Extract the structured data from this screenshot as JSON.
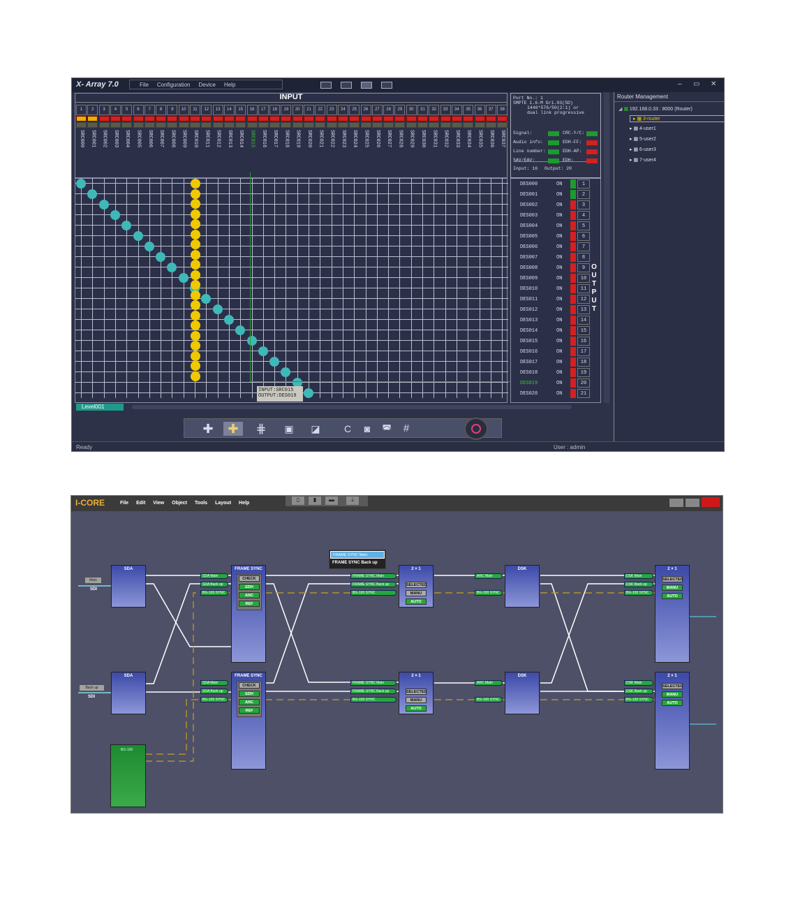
{
  "xarray": {
    "title": "X- Array 7.0",
    "menu": [
      "File",
      "Configuration",
      "Device",
      "Help"
    ],
    "window_controls": [
      "–",
      "▭",
      "✕"
    ],
    "input_header": "INPUT",
    "column_numbers": [
      "1",
      "2",
      "3",
      "4",
      "5",
      "6",
      "7",
      "8",
      "9",
      "10",
      "11",
      "12",
      "13",
      "14",
      "15",
      "16",
      "17",
      "18",
      "19",
      "20",
      "21",
      "22",
      "23",
      "24",
      "25",
      "26",
      "27",
      "28",
      "29",
      "30",
      "31",
      "32",
      "33",
      "34",
      "35",
      "36",
      "37",
      "38"
    ],
    "source_labels": [
      "SRC000",
      "SRC001",
      "SRC002",
      "SRC003",
      "SRC004",
      "SRC005",
      "SRC006",
      "SRC007",
      "SRC008",
      "SRC009",
      "SRC010",
      "SRC011",
      "SRC012",
      "SRC013",
      "SRC014",
      "SRC015",
      "SRC016",
      "SRC017",
      "SRC018",
      "SRC019",
      "SRC020",
      "SRC021",
      "SRC022",
      "SRC023",
      "SRC024",
      "SRC025",
      "SRC026",
      "SRC027",
      "SRC028",
      "SRC029",
      "SRC030",
      "SRC031",
      "SRC032",
      "SRC033",
      "SRC034",
      "SRC035",
      "SRC036",
      "SRC037"
    ],
    "info": {
      "port": "Port No.: 1",
      "format_lines": [
        "SMPTE 1.6-M Gr1.03(SD)",
        "1440*576/50(2:1) or",
        "dual link progressive"
      ],
      "left_items": [
        "Signal:",
        "Audio info:",
        "Line number:",
        "SAV/EAV:"
      ],
      "right_items": [
        "CRC-Y/C:",
        "EDH-FF:",
        "EDH-AP:",
        "EDH:"
      ],
      "left_status": [
        "green",
        "green",
        "green",
        "green"
      ],
      "right_status": [
        "green",
        "red",
        "red",
        "red"
      ],
      "input_label": "Input: 16",
      "output_label": "Output: 20"
    },
    "outputs": [
      {
        "name": "DES000",
        "state": "ON",
        "num": "1",
        "color": "green"
      },
      {
        "name": "DES001",
        "state": "ON",
        "num": "2",
        "color": "green"
      },
      {
        "name": "DES002",
        "state": "ON",
        "num": "3",
        "color": "red"
      },
      {
        "name": "DES003",
        "state": "ON",
        "num": "4",
        "color": "red"
      },
      {
        "name": "DES004",
        "state": "ON",
        "num": "5",
        "color": "red"
      },
      {
        "name": "DES005",
        "state": "ON",
        "num": "6",
        "color": "red"
      },
      {
        "name": "DES006",
        "state": "ON",
        "num": "7",
        "color": "red"
      },
      {
        "name": "DES007",
        "state": "ON",
        "num": "8",
        "color": "red"
      },
      {
        "name": "DES008",
        "state": "ON",
        "num": "9",
        "color": "red"
      },
      {
        "name": "DES009",
        "state": "ON",
        "num": "10",
        "color": "red"
      },
      {
        "name": "DES010",
        "state": "ON",
        "num": "11",
        "color": "red"
      },
      {
        "name": "DES011",
        "state": "ON",
        "num": "12",
        "color": "red"
      },
      {
        "name": "DES012",
        "state": "ON",
        "num": "13",
        "color": "red"
      },
      {
        "name": "DES013",
        "state": "ON",
        "num": "14",
        "color": "red"
      },
      {
        "name": "DES014",
        "state": "ON",
        "num": "15",
        "color": "red"
      },
      {
        "name": "DES015",
        "state": "ON",
        "num": "16",
        "color": "red"
      },
      {
        "name": "DES016",
        "state": "ON",
        "num": "17",
        "color": "red"
      },
      {
        "name": "DES017",
        "state": "ON",
        "num": "18",
        "color": "red"
      },
      {
        "name": "DES018",
        "state": "ON",
        "num": "19",
        "color": "red"
      },
      {
        "name": "DES019",
        "state": "ON",
        "num": "20",
        "color": "red"
      },
      {
        "name": "DES020",
        "state": "ON",
        "num": "21",
        "color": "red"
      }
    ],
    "output_vertical": "OUTPUT",
    "crosshair_tooltip": {
      "input": "INPUT:SRC015",
      "output": "OUTPUT:DES019"
    },
    "level_tab": "Level001",
    "router": {
      "header": "Router Management",
      "root": "192.168.0.33 : 8000 (Router)",
      "children": [
        "3-router",
        "4-user1",
        "5-user2",
        "6-user3",
        "7-user4"
      ],
      "selected": "3-router"
    },
    "status_left": "Ready",
    "status_right": "User : admin",
    "toolbar_icons": [
      "cross-icon",
      "cross-highlight-icon",
      "multi-cross-icon",
      "lock-icon",
      "unlock-icon",
      "clear-icon",
      "lock-all-icon",
      "unlock-all-icon",
      "grid-icon",
      "touch-icon"
    ],
    "colors": {
      "accent_teal": "#3fb8b8",
      "crosspoint_yellow": "#f0c800",
      "status_red": "#d42020",
      "status_green": "#1e9a2e",
      "bg": "#2d3248"
    }
  },
  "icore": {
    "title": "I-CORE",
    "menu": [
      "File",
      "Edit",
      "View",
      "Object",
      "Tools",
      "Layout",
      "Help"
    ],
    "popup": {
      "items": [
        "FRAME SYNC Main",
        "FRAME SYNC Back up"
      ]
    },
    "sdi_label": "SDI",
    "main_label": "Main",
    "backup_label": "Back up",
    "blocks": {
      "sda": "SDA",
      "frame_sync": "FRAME SYNC",
      "switch": "2 × 1",
      "dsk": "DSK",
      "bg": "BG-100"
    },
    "top_row": {
      "fs_inputs": [
        "SDA Main",
        "SDA Back up",
        "BG-100 SYNC"
      ],
      "fs_ctrls": [
        "CHECK",
        "EDH",
        "ANC",
        "REF"
      ],
      "sw1_inputs": [
        "FRAME SYNC Main",
        "FRAME SYNC Back up",
        "BG-100 SYNC"
      ],
      "sw1_ctrls": [
        "SELECTED",
        "MANU",
        "AUTO"
      ],
      "dsk_inputs": [
        "ARC Main",
        "BG-100 SYNC"
      ],
      "sw2_inputs": [
        "DSK Main",
        "DSK Back up",
        "BG-100 SYNC"
      ],
      "sw2_ctrls": [
        "SELECTED",
        "MANU",
        "AUTO"
      ]
    },
    "bottom_row": {
      "fs_inputs": [
        "SDA Main",
        "SDA Back up",
        "BG-100 SYNC"
      ],
      "fs_ctrls": [
        "CHECK",
        "EDH",
        "ANC",
        "REF"
      ],
      "sw1_inputs": [
        "FRAME SYNC Main",
        "FRAME SYNC Back up",
        "BG-100 SYNC"
      ],
      "sw1_ctrls": [
        "SELECTED",
        "MANU",
        "AUTO"
      ],
      "dsk_inputs": [
        "ARC Main",
        "BG-100 SYNC"
      ],
      "sw2_inputs": [
        "DSK Main",
        "DSK Back up",
        "BG-100 SYNC"
      ],
      "sw2_ctrls": [
        "SELECTED",
        "MANU",
        "AUTO"
      ]
    },
    "colors": {
      "bg": "#4d5067",
      "block": "#5a66c0",
      "button_green": "#24a83b",
      "sync_line": "#c8a020",
      "link_line": "#ffffff",
      "title_orange": "#f0b030"
    }
  }
}
